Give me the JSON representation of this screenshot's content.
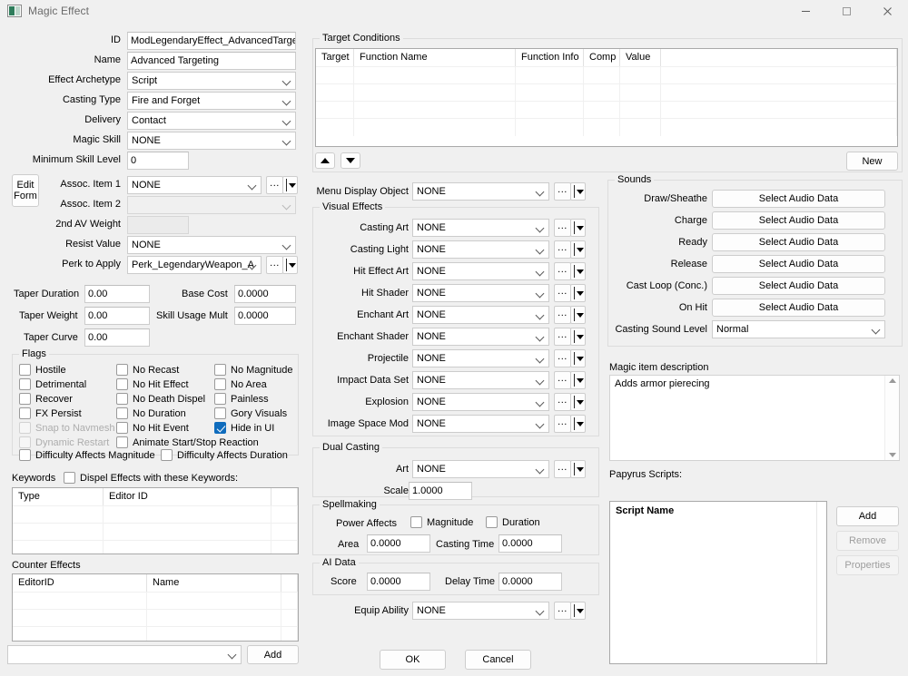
{
  "window": {
    "title": "Magic Effect",
    "icon": "form-window-icon",
    "controls": {
      "minimize": "minimize-icon",
      "maximize": "maximize-icon",
      "close": "close-icon"
    }
  },
  "left": {
    "fields": [
      {
        "label": "ID",
        "value": "ModLegendaryEffect_AdvancedTarge",
        "type": "text"
      },
      {
        "label": "Name",
        "value": "Advanced Targeting",
        "type": "text"
      },
      {
        "label": "Effect Archetype",
        "value": "Script",
        "type": "combo"
      },
      {
        "label": "Casting Type",
        "value": "Fire and Forget",
        "type": "combo"
      },
      {
        "label": "Delivery",
        "value": "Contact",
        "type": "combo"
      },
      {
        "label": "Magic Skill",
        "value": "NONE",
        "type": "combo"
      },
      {
        "label": "Minimum Skill Level",
        "value": "0",
        "type": "text"
      }
    ],
    "edit_form_button": "Edit\nForm",
    "edit_form_line1": "Edit",
    "edit_form_line2": "Form",
    "assoc_item_1": {
      "label": "Assoc. Item 1",
      "value": "NONE"
    },
    "assoc_item_2": {
      "label": "Assoc. Item 2",
      "value": ""
    },
    "second_av_weight": {
      "label": "2nd AV Weight",
      "value": ""
    },
    "resist_value": {
      "label": "Resist Value",
      "value": "NONE"
    },
    "perk_to_apply": {
      "label": "Perk to Apply",
      "value": "Perk_LegendaryWeapon_A"
    },
    "numeric": [
      {
        "label": "Taper Duration",
        "value": "0.00"
      },
      {
        "label": "Taper Weight",
        "value": "0.00"
      },
      {
        "label": "Taper Curve",
        "value": "0.00"
      },
      {
        "label": "Base Cost",
        "value": "0.0000"
      },
      {
        "label": "Skill Usage Mult",
        "value": "0.0000"
      }
    ],
    "flags": {
      "title": "Flags",
      "col1": [
        {
          "label": "Hostile",
          "checked": false,
          "disabled": false
        },
        {
          "label": "Detrimental",
          "checked": false,
          "disabled": false
        },
        {
          "label": "Recover",
          "checked": false,
          "disabled": false
        },
        {
          "label": "FX Persist",
          "checked": false,
          "disabled": false
        },
        {
          "label": "Snap to Navmesh",
          "checked": false,
          "disabled": true
        },
        {
          "label": "Dynamic Restart",
          "checked": false,
          "disabled": true
        }
      ],
      "col2": [
        {
          "label": "No Recast",
          "checked": false,
          "disabled": false
        },
        {
          "label": "No Hit Effect",
          "checked": false,
          "disabled": false
        },
        {
          "label": "No Death Dispel",
          "checked": false,
          "disabled": false
        },
        {
          "label": "No Duration",
          "checked": false,
          "disabled": false
        },
        {
          "label": "No Hit Event",
          "checked": false,
          "disabled": false
        },
        {
          "label": "Animate Start/Stop Reaction",
          "checked": false,
          "disabled": false
        }
      ],
      "col3": [
        {
          "label": "No Magnitude",
          "checked": false,
          "disabled": false
        },
        {
          "label": "No Area",
          "checked": false,
          "disabled": false
        },
        {
          "label": "Painless",
          "checked": false,
          "disabled": false
        },
        {
          "label": "Gory Visuals",
          "checked": false,
          "disabled": false
        },
        {
          "label": "Hide in UI",
          "checked": true,
          "disabled": false
        }
      ],
      "bottom": [
        {
          "label": "Difficulty Affects Magnitude",
          "checked": false
        },
        {
          "label": "Difficulty Affects Duration",
          "checked": false
        }
      ]
    },
    "keywords": {
      "title": "Keywords",
      "dispel_label": "Dispel Effects with these Keywords:",
      "dispel_checked": false,
      "columns": [
        "Type",
        "Editor ID"
      ],
      "rows": []
    },
    "counter_effects": {
      "title": "Counter Effects",
      "columns": [
        "EditorID",
        "Name"
      ],
      "rows": []
    },
    "counter_combo_value": "",
    "add_button": "Add"
  },
  "center": {
    "target_conditions": {
      "title": "Target Conditions",
      "columns": [
        "Target",
        "Function Name",
        "Function Info",
        "Comp",
        "Value"
      ],
      "rows": [],
      "move_up": "move-up",
      "move_down": "move-down",
      "new_button": "New"
    },
    "menu_display_object": {
      "label": "Menu Display Object",
      "value": "NONE"
    },
    "visual_effects": {
      "title": "Visual Effects",
      "fields": [
        {
          "label": "Casting Art",
          "value": "NONE"
        },
        {
          "label": "Casting Light",
          "value": "NONE"
        },
        {
          "label": "Hit Effect Art",
          "value": "NONE"
        },
        {
          "label": "Hit Shader",
          "value": "NONE"
        },
        {
          "label": "Enchant Art",
          "value": "NONE"
        },
        {
          "label": "Enchant Shader",
          "value": "NONE"
        },
        {
          "label": "Projectile",
          "value": "NONE"
        },
        {
          "label": "Impact Data Set",
          "value": "NONE"
        },
        {
          "label": "Explosion",
          "value": "NONE"
        },
        {
          "label": "Image Space Mod",
          "value": "NONE"
        }
      ]
    },
    "dual_casting": {
      "title": "Dual Casting",
      "art": {
        "label": "Art",
        "value": "NONE"
      },
      "scale": {
        "label": "Scale",
        "value": "1.0000"
      }
    },
    "spellmaking": {
      "title": "Spellmaking",
      "power_affects_label": "Power Affects",
      "magnitude": {
        "label": "Magnitude",
        "checked": false
      },
      "duration": {
        "label": "Duration",
        "checked": false
      },
      "area": {
        "label": "Area",
        "value": "0.0000"
      },
      "casting_time": {
        "label": "Casting Time",
        "value": "0.0000"
      }
    },
    "ai_data": {
      "title": "AI Data",
      "score": {
        "label": "Score",
        "value": "0.0000"
      },
      "delay_time": {
        "label": "Delay Time",
        "value": "0.0000"
      }
    },
    "equip_ability": {
      "label": "Equip Ability",
      "value": "NONE"
    },
    "ok_button": "OK",
    "cancel_button": "Cancel"
  },
  "right": {
    "sounds": {
      "title": "Sounds",
      "rows": [
        {
          "label": "Draw/Sheathe",
          "button": "Select Audio Data"
        },
        {
          "label": "Charge",
          "button": "Select Audio Data"
        },
        {
          "label": "Ready",
          "button": "Select Audio Data"
        },
        {
          "label": "Release",
          "button": "Select Audio Data"
        },
        {
          "label": "Cast Loop (Conc.)",
          "button": "Select Audio Data"
        },
        {
          "label": "On Hit",
          "button": "Select Audio Data"
        }
      ],
      "casting_sound_level": {
        "label": "Casting Sound Level",
        "value": "Normal"
      }
    },
    "magic_item_description": {
      "label": "Magic item description",
      "value": "Adds armor pierecing"
    },
    "papyrus": {
      "label": "Papyrus Scripts:",
      "column": "Script Name",
      "rows": [],
      "add_button": "Add",
      "remove_button": "Remove",
      "properties_button": "Properties"
    }
  },
  "colors": {
    "window_bg": "#f0f0f0",
    "field_bg": "#ffffff",
    "accent_checked": "#0f6cbd",
    "border": "#cccccc",
    "title_text": "#6a6a6a"
  }
}
